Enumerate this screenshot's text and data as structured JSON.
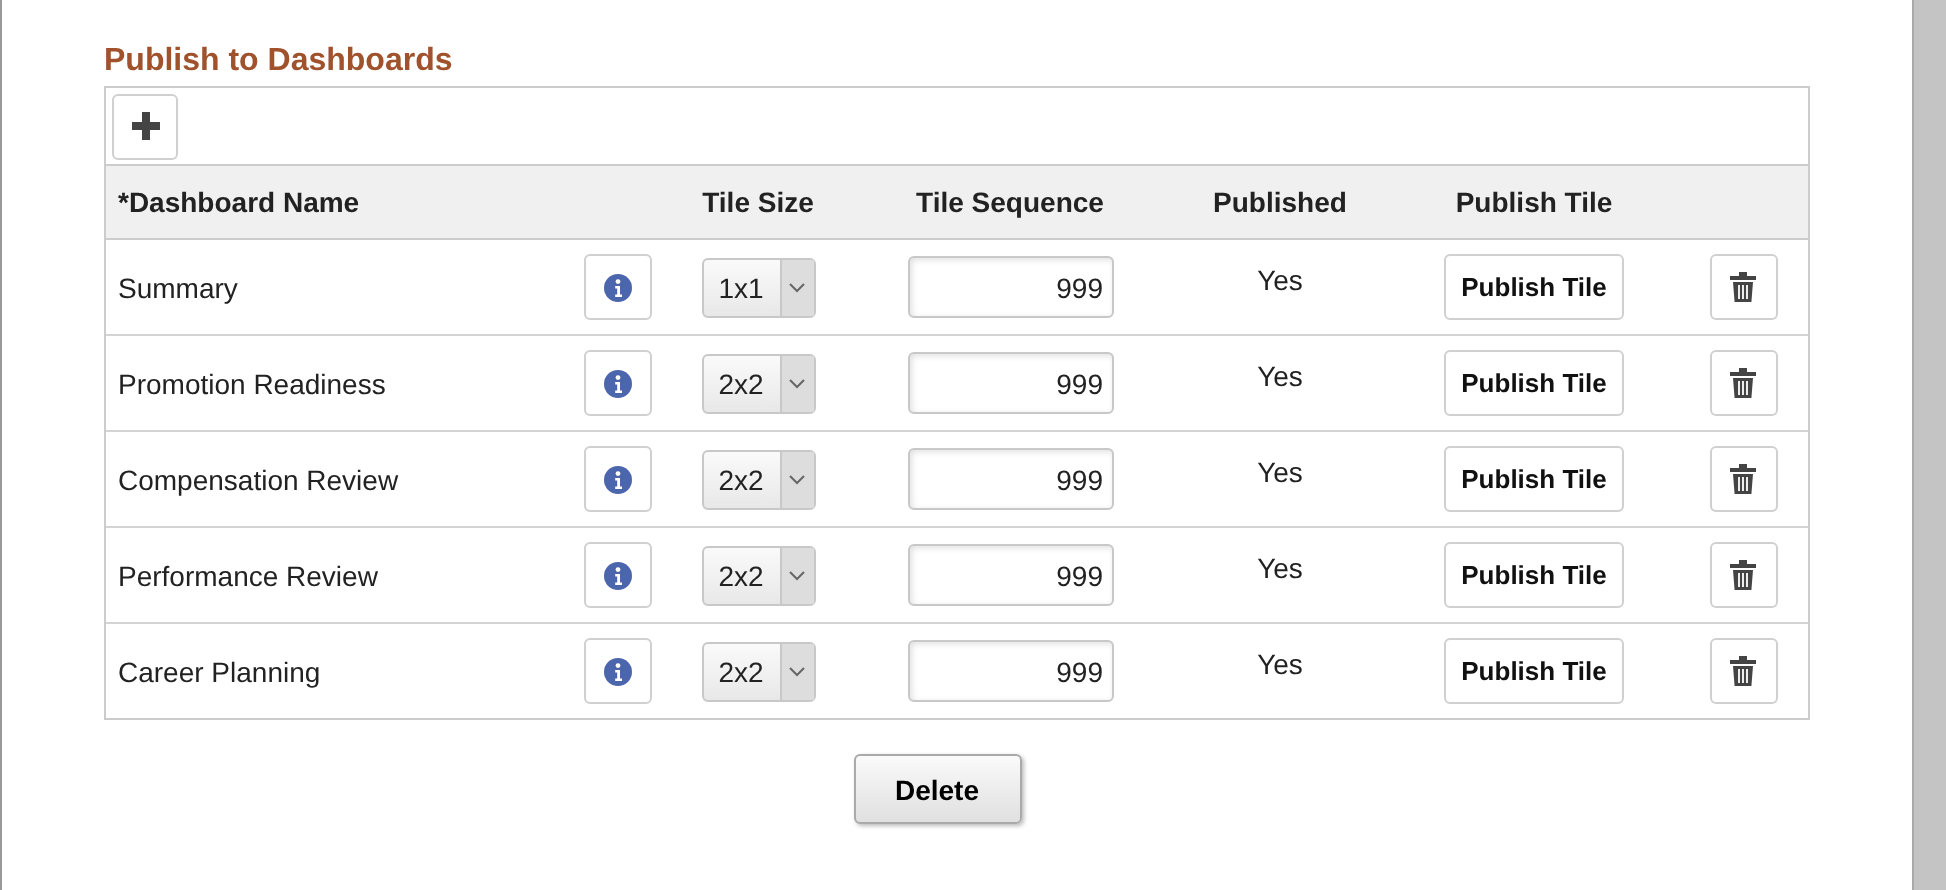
{
  "section": {
    "title": "Publish to Dashboards"
  },
  "table": {
    "columns": [
      "*Dashboard Name",
      "Tile Size",
      "Tile Sequence",
      "Published",
      "Publish Tile"
    ],
    "rows": [
      {
        "name": "Summary",
        "tile_size": "1x1",
        "tile_sequence": "999",
        "published": "Yes",
        "publish_button": "Publish Tile"
      },
      {
        "name": "Promotion Readiness",
        "tile_size": "2x2",
        "tile_sequence": "999",
        "published": "Yes",
        "publish_button": "Publish Tile"
      },
      {
        "name": "Compensation Review",
        "tile_size": "2x2",
        "tile_sequence": "999",
        "published": "Yes",
        "publish_button": "Publish Tile"
      },
      {
        "name": "Performance Review",
        "tile_size": "2x2",
        "tile_sequence": "999",
        "published": "Yes",
        "publish_button": "Publish Tile"
      },
      {
        "name": "Career Planning",
        "tile_size": "2x2",
        "tile_sequence": "999",
        "published": "Yes",
        "publish_button": "Publish Tile"
      }
    ]
  },
  "delete_button": "Delete"
}
